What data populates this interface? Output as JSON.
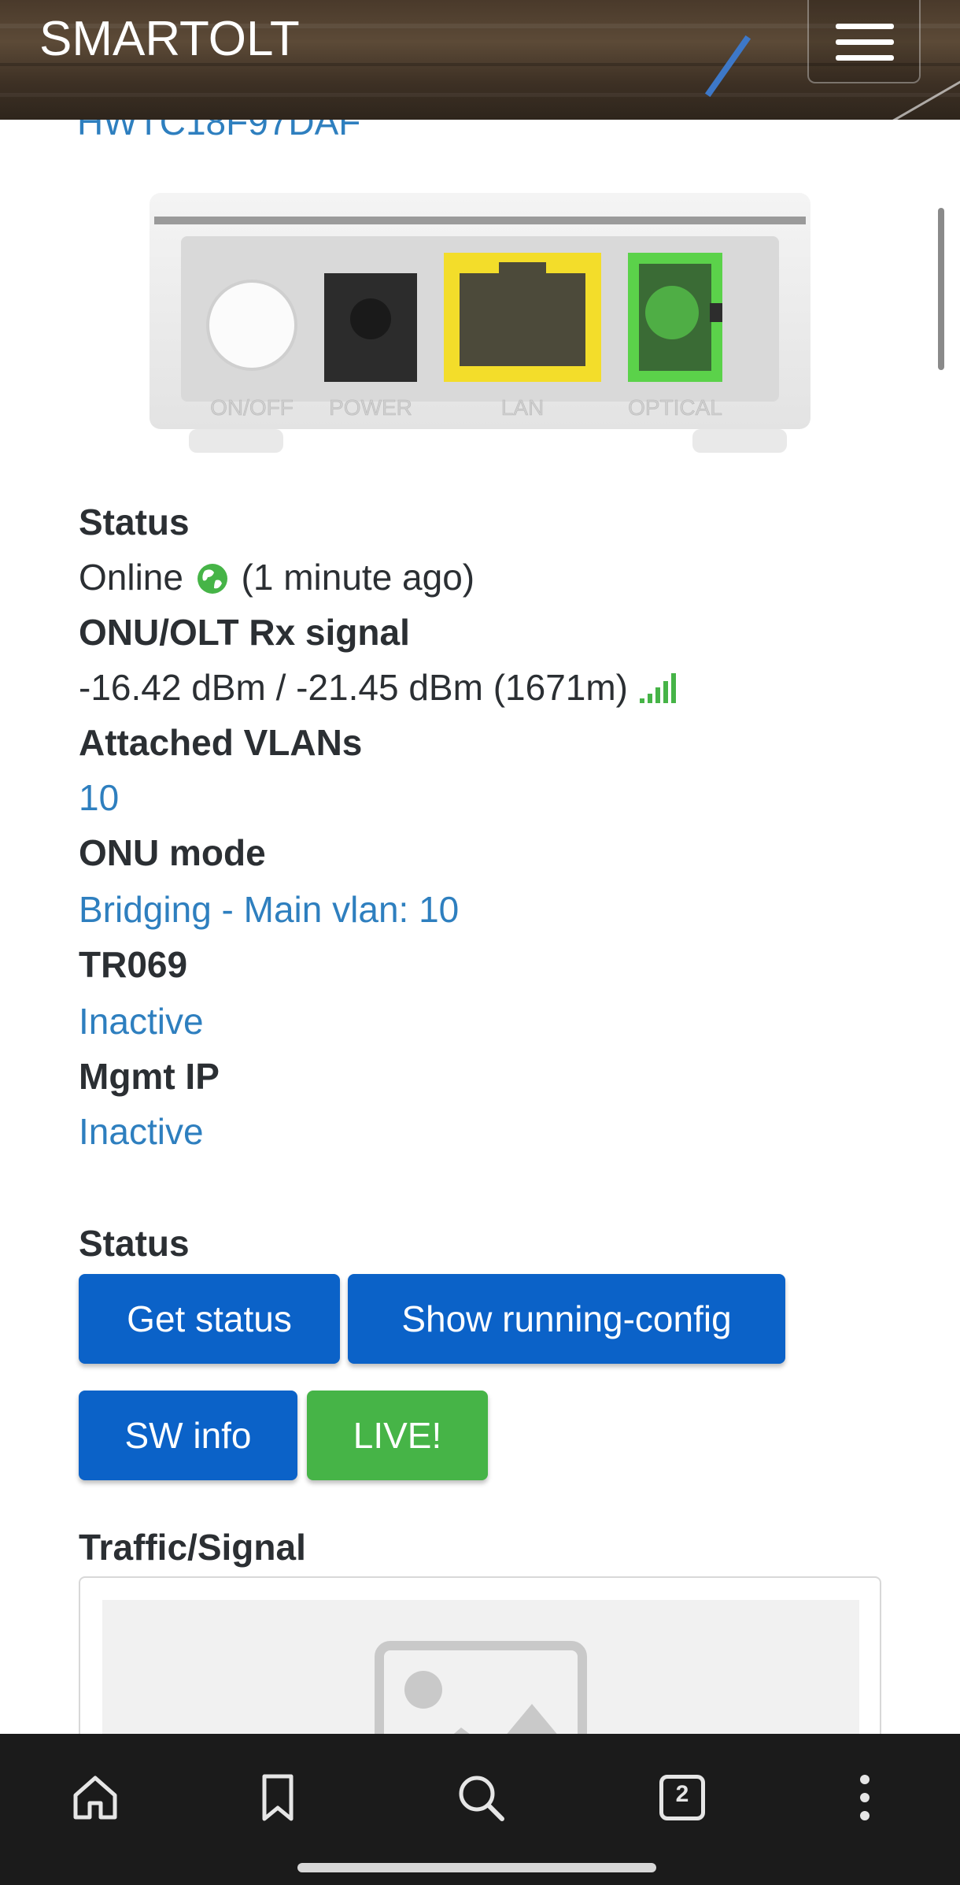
{
  "header": {
    "brand": "SMARTOLT",
    "menu_icon": "hamburger-icon"
  },
  "partial_title": "HWTC18F97DAF",
  "device_ports": [
    "ON/OFF",
    "POWER",
    "LAN",
    "OPTICAL"
  ],
  "details": {
    "status_label": "Status",
    "status_value": "Online",
    "status_time": "(1 minute ago)",
    "signal_label": "ONU/OLT Rx signal",
    "signal_value": "-16.42 dBm / -21.45 dBm (1671m)",
    "vlans_label": "Attached VLANs",
    "vlans_value": "10",
    "mode_label": "ONU mode",
    "mode_value": "Bridging - Main vlan: 10",
    "tr069_label": "TR069",
    "tr069_value": "Inactive",
    "mgmt_label": "Mgmt IP",
    "mgmt_value": "Inactive"
  },
  "status_section": {
    "title": "Status",
    "buttons": {
      "get_status": "Get status",
      "running_config": "Show running-config",
      "sw_info": "SW info",
      "live": "LIVE!"
    }
  },
  "traffic": {
    "title": "Traffic/Signal"
  },
  "bottom_nav": {
    "tabs_count": "2",
    "icons": [
      "home-icon",
      "bookmark-icon",
      "search-icon",
      "tabs-icon",
      "more-icon"
    ]
  },
  "colors": {
    "link": "#2e7fbf",
    "button_blue": "#0b62c8",
    "button_green": "#46b447",
    "online_green": "#46b447"
  }
}
